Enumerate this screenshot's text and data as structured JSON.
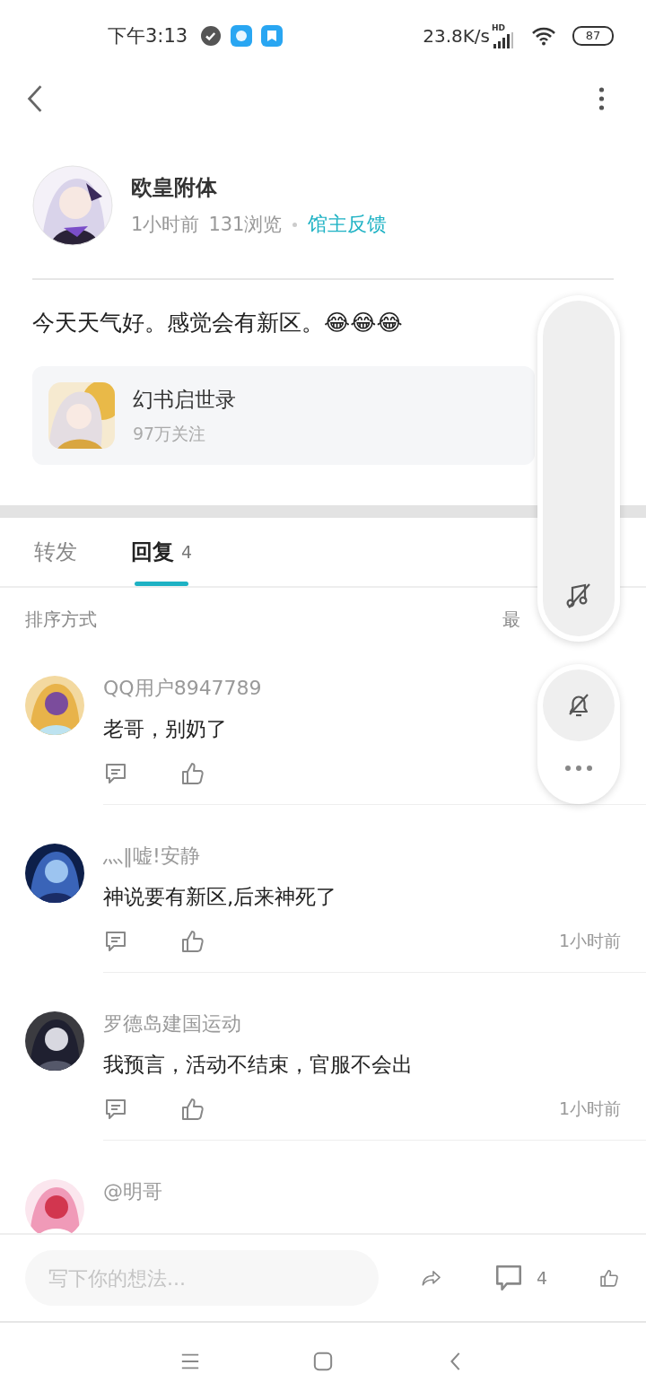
{
  "status_bar": {
    "time": "下午3:13",
    "speed": "23.8K/s",
    "network": "HD",
    "battery": "87"
  },
  "post": {
    "author": "欧皇附体",
    "time": "1小时前",
    "views": "131浏览",
    "tag": "馆主反馈",
    "text": "今天天气好。感觉会有新区。😂😂😂"
  },
  "game_card": {
    "name": "幻书启世录",
    "followers": "97万关注"
  },
  "tabs": [
    {
      "label": "转发",
      "selected": false
    },
    {
      "label": "回复",
      "count": "4",
      "selected": true
    }
  ],
  "sort": {
    "label": "排序方式",
    "value": "最"
  },
  "comments": [
    {
      "user": "QQ用户8947789",
      "text": "老哥，别奶了"
    },
    {
      "user": "灬‖嘘!安静",
      "text": "神说要有新区,后来神死了",
      "time": "1小时前"
    },
    {
      "user": "罗德岛建国运动",
      "text": "我预言，活动不结束，官服不会出",
      "time": "1小时前"
    },
    {
      "user": "@明哥"
    }
  ],
  "composer": {
    "placeholder": "写下你的想法...",
    "comment_count": "4"
  }
}
